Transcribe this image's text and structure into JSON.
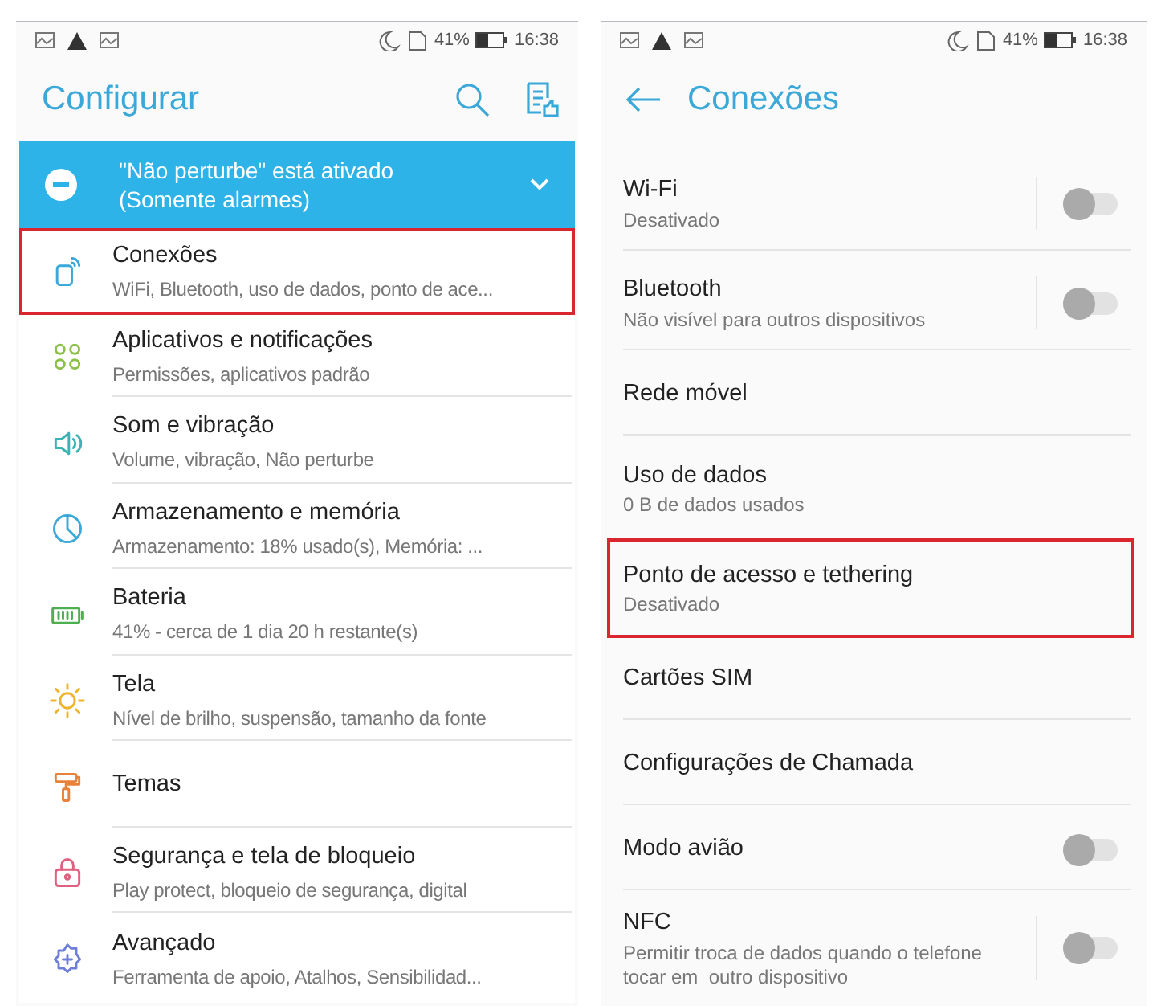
{
  "screens": [
    {
      "status_bar": {
        "battery": "41%",
        "time": "16:38"
      },
      "title": "Configurar",
      "back": false,
      "banner": {
        "title": "\"Não perturbe\" está ativado",
        "subtitle": "(Somente alarmes)"
      },
      "items": [
        {
          "title": "Conexões",
          "subtitle": "WiFi, Bluetooth, uso de dados, ponto de ace...",
          "highlighted": true
        },
        {
          "title": "Aplicativos e notificações",
          "subtitle": "Permissões, aplicativos padrão",
          "highlighted": false
        },
        {
          "title": "Som e vibração",
          "subtitle": "Volume, vibração, Não perturbe",
          "highlighted": false
        },
        {
          "title": "Armazenamento e memória",
          "subtitle": "Armazenamento: 18% usado(s), Memória: ...",
          "highlighted": false
        },
        {
          "title": "Bateria",
          "subtitle": "41% - cerca de 1 dia 20 h restante(s)",
          "highlighted": false
        },
        {
          "title": "Tela",
          "subtitle": "Nível de brilho, suspensão, tamanho da fonte",
          "highlighted": false
        },
        {
          "title": "Temas",
          "highlighted": false
        },
        {
          "title": "Segurança e tela de bloqueio",
          "subtitle": "Play protect, bloqueio de segurança, digital",
          "highlighted": false
        },
        {
          "title": "Avançado",
          "subtitle": "Ferramenta de apoio, Atalhos, Sensibilidad...",
          "highlighted": false
        }
      ]
    },
    {
      "status_bar": {
        "battery": "41%",
        "time": "16:38"
      },
      "title": "Conexões",
      "back": true,
      "items": [
        {
          "kind": "split-toggle",
          "title": "Wi-Fi",
          "subtitle": "Desativado",
          "on": false,
          "highlighted": false
        },
        {
          "kind": "split-toggle",
          "title": "Bluetooth",
          "subtitle": "Não visível para outros dispositivos",
          "on": false,
          "highlighted": false
        },
        {
          "kind": "plain",
          "title": "Rede móvel",
          "highlighted": false
        },
        {
          "kind": "plain",
          "title": "Uso de dados",
          "subtitle": "0 B de dados usados",
          "highlighted": false
        },
        {
          "kind": "plain",
          "title": "Ponto de acesso e tethering",
          "subtitle": "Desativado",
          "highlighted": true
        },
        {
          "kind": "plain",
          "title": "Cartões SIM",
          "highlighted": false
        },
        {
          "kind": "plain",
          "title": "Configurações de Chamada",
          "highlighted": false
        },
        {
          "kind": "toggle",
          "title": "Modo avião",
          "on": false,
          "highlighted": false
        },
        {
          "kind": "split-toggle",
          "title": "NFC",
          "subtitle": "Permitir troca de dados quando o telefone tocar em  outro dispositivo",
          "on": false,
          "highlighted": false
        }
      ]
    }
  ]
}
